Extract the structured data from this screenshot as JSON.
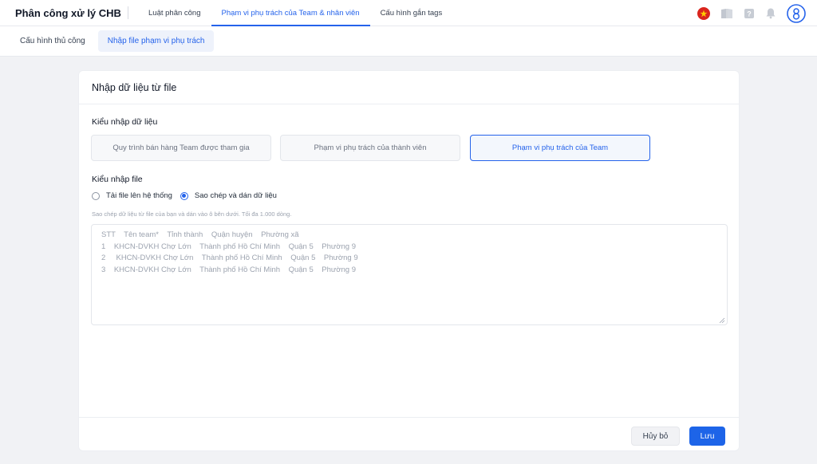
{
  "app": {
    "title": "Phân công xử lý CHB"
  },
  "top_tabs": [
    {
      "label": "Luật phân công"
    },
    {
      "label": "Phạm vi phụ trách của Team & nhân viên"
    },
    {
      "label": "Cấu hình gắn tags"
    }
  ],
  "sub_tabs": [
    {
      "label": "Cấu hình thủ công"
    },
    {
      "label": "Nhập file phạm vi phụ trách"
    }
  ],
  "card": {
    "title": "Nhập dữ liệu từ file",
    "import_type_label": "Kiểu nhập dữ liệu",
    "import_type_options": [
      {
        "label": "Quy trình bán hàng Team được tham gia"
      },
      {
        "label": "Phạm vi phụ trách của thành viên"
      },
      {
        "label": "Phạm vi phụ trách của Team"
      }
    ],
    "file_type_label": "Kiểu nhập file",
    "radio_options": [
      {
        "label": "Tải file lên hệ thống"
      },
      {
        "label": "Sao chép và dán dữ liệu"
      }
    ],
    "hint": "Sao chép dữ liệu từ file của bạn và dán vào ô bên dưới. Tối đa 1.000 dòng.",
    "textarea_placeholder_lines": [
      "STT    Tên team*    Tỉnh thành    Quận huyện    Phường xã",
      "1    KHCN-DVKH Chợ Lớn    Thành phố Hồ Chí Minh    Quận 5    Phường 9",
      "2     KHCN-DVKH Chợ Lớn    Thành phố Hồ Chí Minh    Quận 5    Phường 9",
      "3    KHCN-DVKH Chợ Lớn    Thành phố Hồ Chí Minh    Quận 5    Phường 9"
    ]
  },
  "footer": {
    "cancel_label": "Hủy bỏ",
    "save_label": "Lưu"
  },
  "icons": {
    "language": "vietnam-flag-icon",
    "guide": "book-icon",
    "help": "help-icon",
    "notifications": "bell-icon",
    "account": "user-avatar-icon"
  },
  "colors": {
    "accent": "#2563eb",
    "save_button": "#1d64e8",
    "flag_red": "#da251d",
    "flag_star": "#ffcd00"
  }
}
